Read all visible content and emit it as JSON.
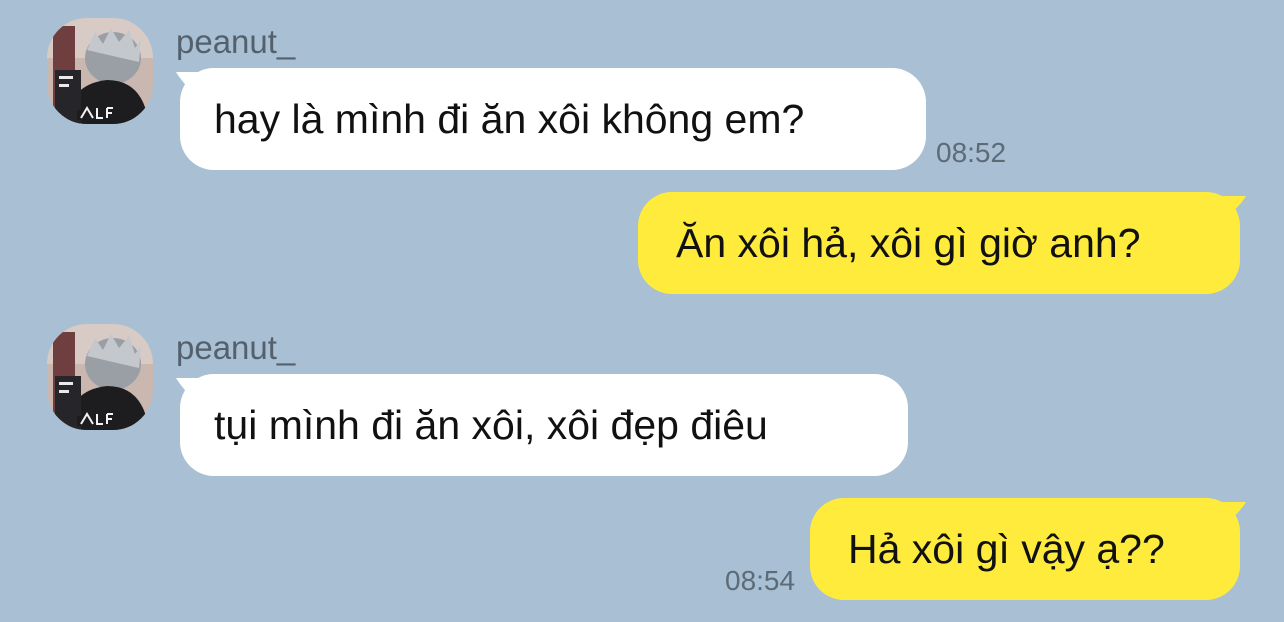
{
  "chat": {
    "messages": [
      {
        "direction": "incoming",
        "sender": "peanut_",
        "text": "hay là mình đi ăn xôi không em?",
        "time": "08:52",
        "avatar_icon": "profile-photo"
      },
      {
        "direction": "outgoing",
        "text": "Ăn xôi hả, xôi gì giờ anh?"
      },
      {
        "direction": "incoming",
        "sender": "peanut_",
        "text": "tụi mình đi ăn xôi, xôi đẹp điêu",
        "avatar_icon": "profile-photo"
      },
      {
        "direction": "outgoing",
        "text": "Hả xôi gì vậy ạ??",
        "time": "08:54"
      }
    ]
  },
  "colors": {
    "background": "#a9bfd3",
    "incoming_bubble": "#ffffff",
    "outgoing_bubble": "#ffeb3b",
    "sender_name": "#54616d",
    "timestamp": "#5c6b78"
  }
}
